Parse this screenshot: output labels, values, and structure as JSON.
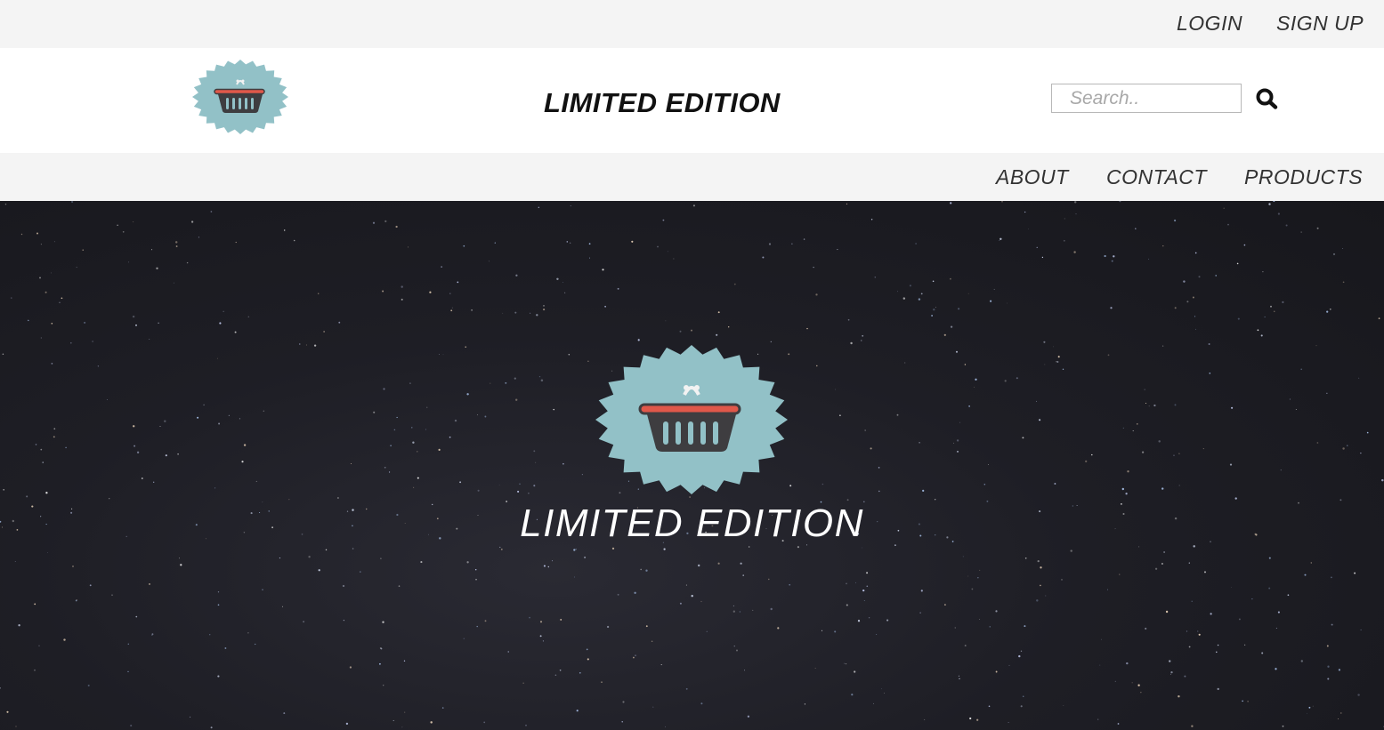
{
  "topbar": {
    "login_label": "LOGIN",
    "signup_label": "SIGN UP"
  },
  "header": {
    "brand": "LIMITED EDITION",
    "search_placeholder": "Search..",
    "search_icon": "search-icon",
    "logo_icon": "shopping-basket-icon"
  },
  "nav": {
    "items": [
      {
        "label": "ABOUT"
      },
      {
        "label": "CONTACT"
      },
      {
        "label": "PRODUCTS"
      }
    ]
  },
  "hero": {
    "title": "LIMITED EDITION",
    "logo_icon": "shopping-basket-icon"
  },
  "colors": {
    "bar_background": "#f4f4f4",
    "badge": "#92c1c7",
    "basket": "#3e3d40",
    "basket_rim": "#e0584a",
    "hero_background": "#1e1e25"
  }
}
